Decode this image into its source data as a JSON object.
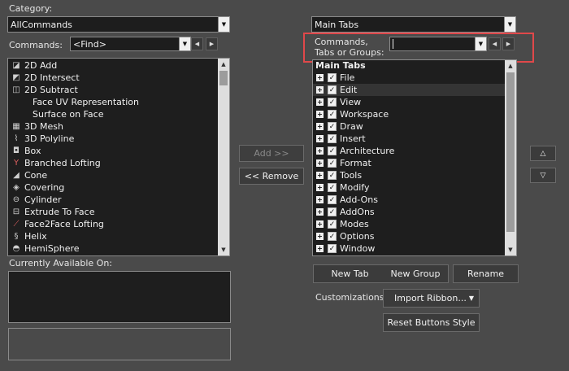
{
  "category": {
    "label": "Category:",
    "value": "AllCommands"
  },
  "commands": {
    "label": "Commands:",
    "find_value": "<Find>",
    "items": [
      {
        "label": "2D Add",
        "icon": "add-2d-icon"
      },
      {
        "label": "2D Intersect",
        "icon": "intersect-2d-icon"
      },
      {
        "label": "2D Subtract",
        "icon": "subtract-2d-icon"
      },
      {
        "label": "Face UV Representation",
        "icon": ""
      },
      {
        "label": "Surface on Face",
        "icon": ""
      },
      {
        "label": "3D Mesh",
        "icon": "mesh-3d-icon"
      },
      {
        "label": "3D Polyline",
        "icon": "polyline-3d-icon"
      },
      {
        "label": "Box",
        "icon": "box-icon"
      },
      {
        "label": "Branched Lofting",
        "icon": "branched-lofting-icon"
      },
      {
        "label": "Cone",
        "icon": "cone-icon"
      },
      {
        "label": "Covering",
        "icon": "covering-icon"
      },
      {
        "label": "Cylinder",
        "icon": "cylinder-icon"
      },
      {
        "label": "Extrude To Face",
        "icon": "extrude-to-face-icon"
      },
      {
        "label": "Face2Face Lofting",
        "icon": "face2face-lofting-icon"
      },
      {
        "label": "Helix",
        "icon": "helix-icon"
      },
      {
        "label": "HemiSphere",
        "icon": "hemisphere-icon"
      }
    ]
  },
  "currently_available": {
    "label": "Currently Available On:"
  },
  "buttons": {
    "add": "Add >>",
    "remove": "<< Remove",
    "new_tab": "New Tab",
    "new_group": "New Group",
    "rename": "Rename",
    "import_ribbon": "Import Ribbon...",
    "reset_buttons_style": "Reset Buttons Style"
  },
  "tabs_combo": {
    "value": "Main Tabs"
  },
  "search": {
    "label": "Commands, Tabs or Groups:",
    "value": ""
  },
  "tree": {
    "header": "Main Tabs",
    "items": [
      "File",
      "Edit",
      "View",
      "Workspace",
      "Draw",
      "Insert",
      "Architecture",
      "Format",
      "Tools",
      "Modify",
      "Add-Ons",
      "AddOns",
      "Modes",
      "Options",
      "Window"
    ]
  },
  "customizations": {
    "label": "Customizations:"
  },
  "colors": {
    "highlight_box": "#e0484a",
    "background": "#4a4a4a",
    "list_bg": "#1e1e1e"
  }
}
